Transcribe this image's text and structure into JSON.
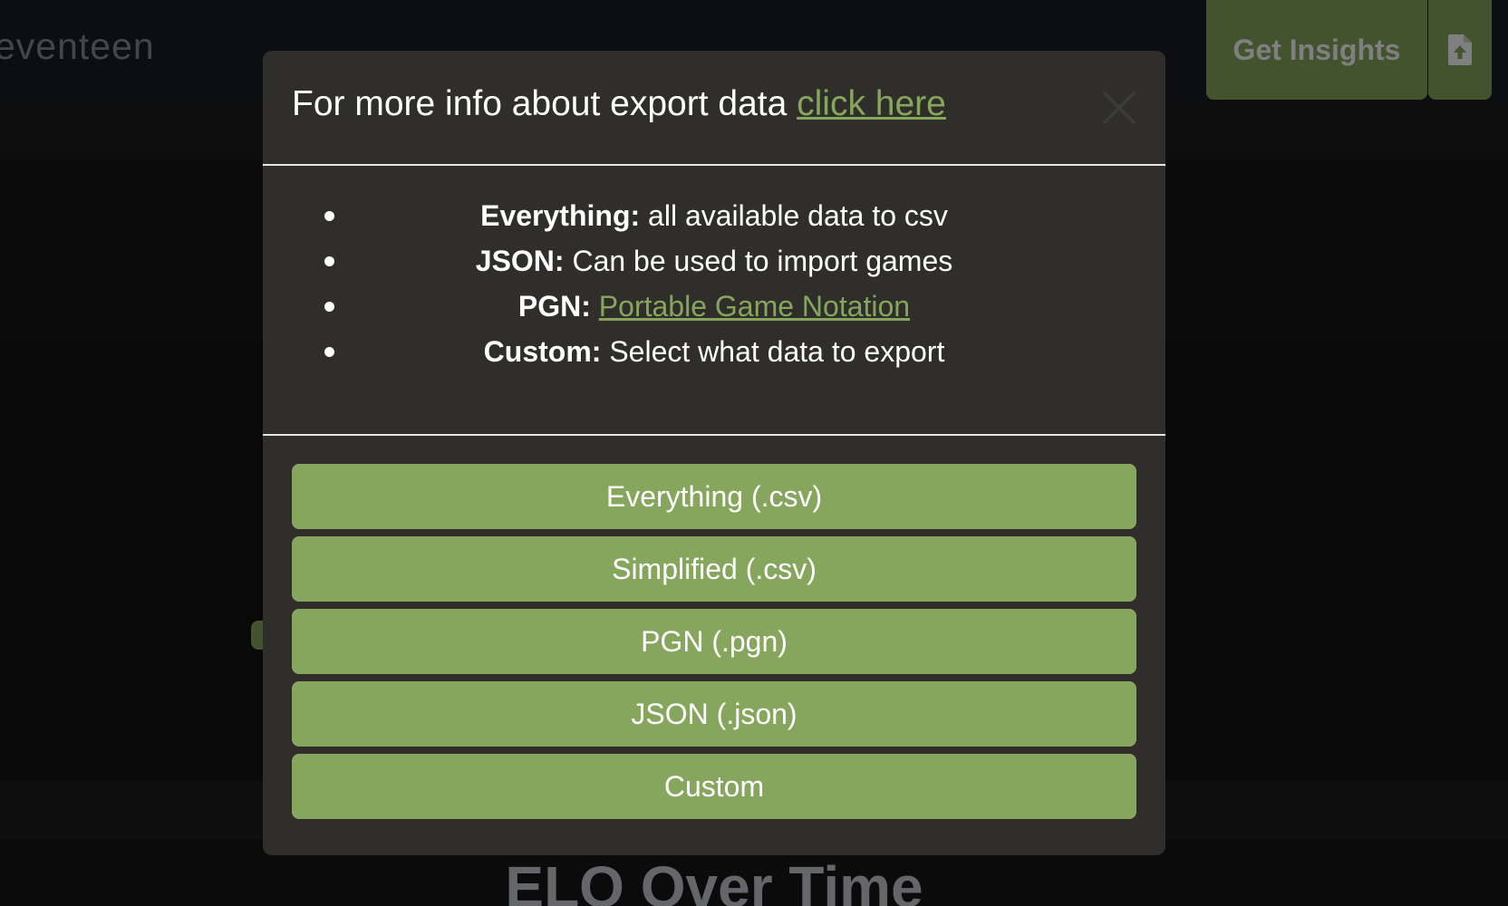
{
  "header": {
    "brand_text": "eventeen",
    "insights_label": "Get Insights",
    "export_icon": "file-upload-icon"
  },
  "background": {
    "chart_heading": "ELO Over Time"
  },
  "modal": {
    "title_prefix": "For more info about export data ",
    "title_link": "click here",
    "close_icon": "close-icon",
    "items": [
      {
        "label": "Everything:",
        "text": " all available data to csv"
      },
      {
        "label": "JSON:",
        "text": " Can be used to import games"
      },
      {
        "label": "PGN:",
        "link": "Portable Game Notation"
      },
      {
        "label": "Custom:",
        "text": " Select what data to export"
      }
    ],
    "buttons": [
      "Everything (.csv)",
      "Simplified (.csv)",
      "PGN (.pgn)",
      "JSON (.json)",
      "Custom"
    ]
  },
  "colors": {
    "accent_green": "#86a65d",
    "modal_bg": "#302e2b",
    "topbar_bg": "#1a1d26"
  }
}
